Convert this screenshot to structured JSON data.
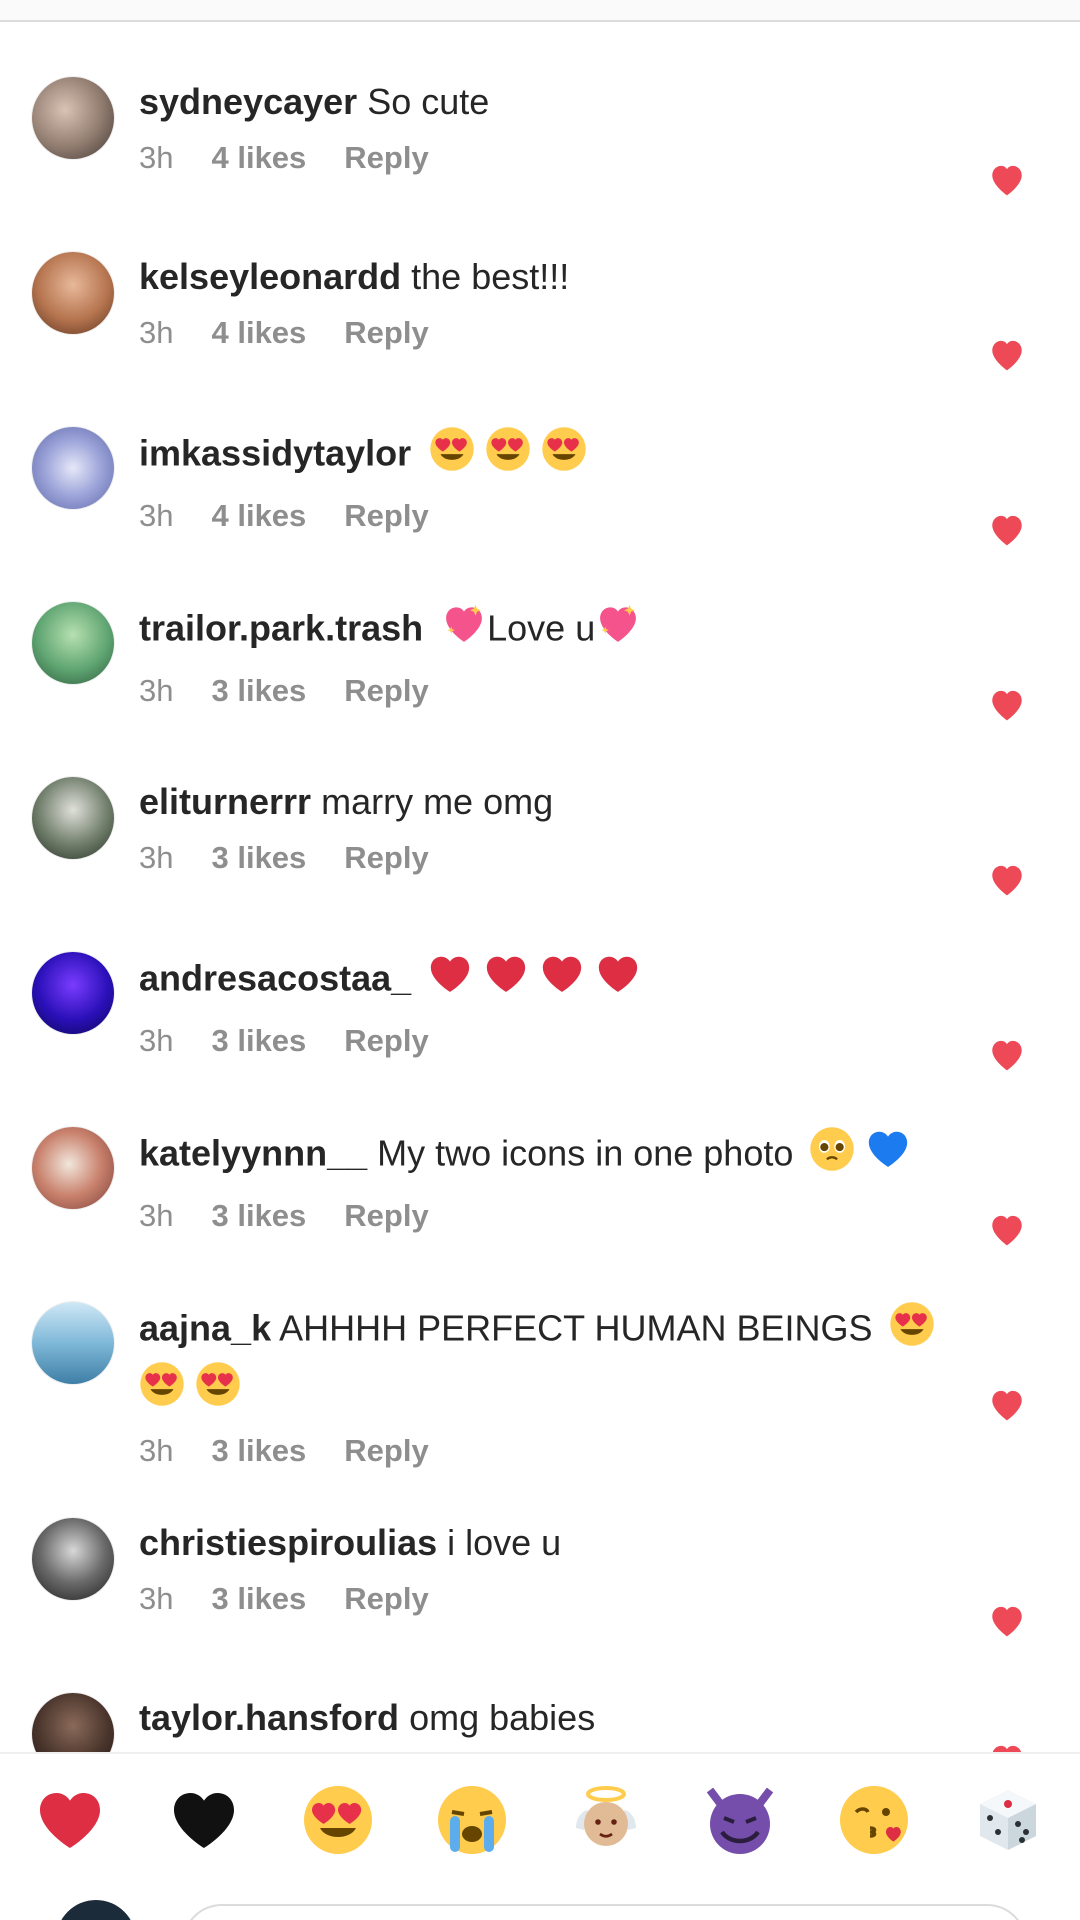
{
  "colors": {
    "heart": "#ed4956",
    "meta": "#8e8e8e",
    "text": "#262626"
  },
  "comments": [
    {
      "username": "sydneycayer",
      "text": "So cute",
      "time": "3h",
      "likes": "4 likes",
      "reply": "Reply"
    },
    {
      "username": "kelseyleonardd",
      "text": "the best!!!",
      "time": "3h",
      "likes": "4 likes",
      "reply": "Reply"
    },
    {
      "username": "imkassidytaylor",
      "text": "",
      "emojis": [
        "heart-eyes",
        "heart-eyes",
        "heart-eyes"
      ],
      "time": "3h",
      "likes": "4 likes",
      "reply": "Reply"
    },
    {
      "username": "trailor.park.trash",
      "text": "Love u",
      "emojis": [
        "sparkling-heart",
        "sparkling-heart"
      ],
      "time": "3h",
      "likes": "3 likes",
      "reply": "Reply"
    },
    {
      "username": "eliturnerrr",
      "text": "marry me omg",
      "time": "3h",
      "likes": "3 likes",
      "reply": "Reply"
    },
    {
      "username": "andresacostaa_",
      "text": "",
      "emojis": [
        "red-heart",
        "red-heart",
        "red-heart",
        "red-heart"
      ],
      "time": "3h",
      "likes": "3 likes",
      "reply": "Reply"
    },
    {
      "username": "katelyynnn__",
      "text": "My two icons in one photo",
      "emojis": [
        "pleading-face",
        "blue-heart"
      ],
      "time": "3h",
      "likes": "3 likes",
      "reply": "Reply"
    },
    {
      "username": "aajna_k",
      "text": "AHHHH PERFECT HUMAN BEINGS",
      "emojis": [
        "heart-eyes",
        "heart-eyes",
        "heart-eyes"
      ],
      "time": "3h",
      "likes": "3 likes",
      "reply": "Reply"
    },
    {
      "username": "christiespiroulias",
      "text": "i love u",
      "time": "3h",
      "likes": "3 likes",
      "reply": "Reply"
    },
    {
      "username": "taylor.hansford",
      "text": "omg babies",
      "time": "",
      "likes": "",
      "reply": ""
    }
  ],
  "emoji_bar": [
    "red-heart",
    "black-heart",
    "heart-eyes",
    "crying-face",
    "baby-angel",
    "smiling-imp",
    "kissing-heart",
    "game-die"
  ]
}
